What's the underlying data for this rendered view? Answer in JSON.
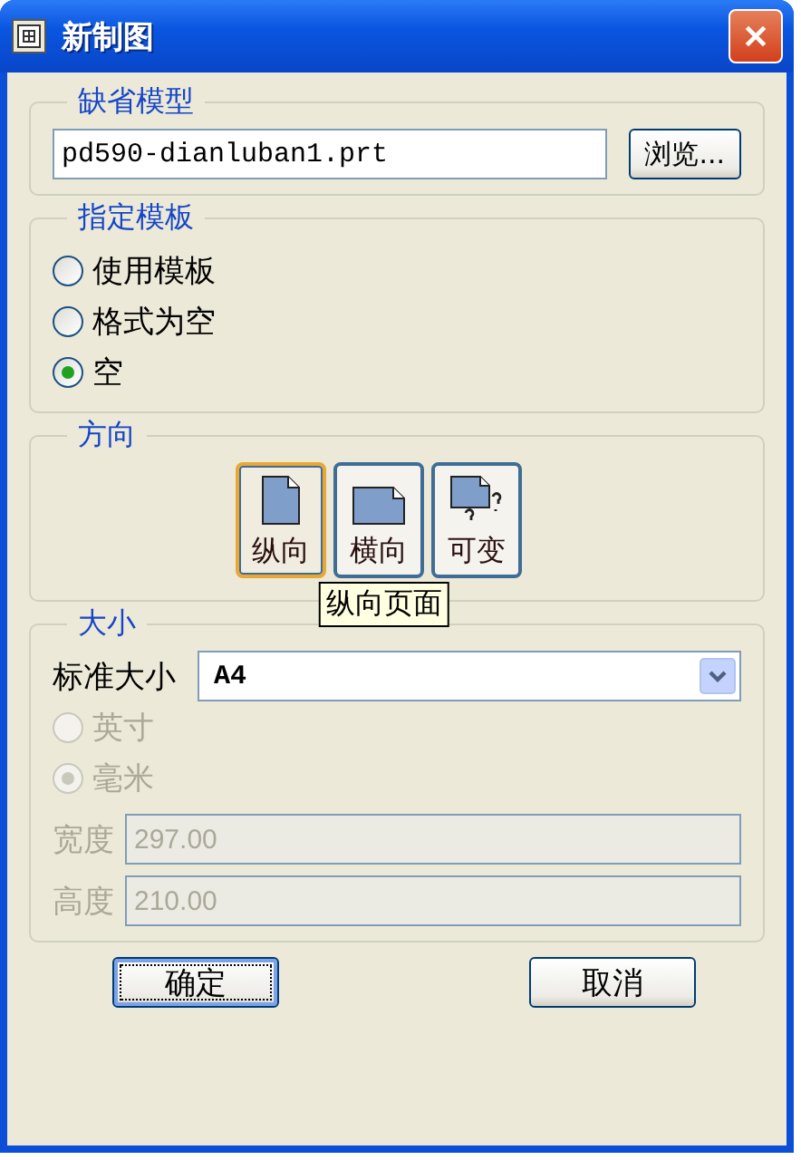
{
  "window": {
    "title": "新制图"
  },
  "default_model": {
    "legend": "缺省模型",
    "value": "pd590-dianluban1.prt",
    "browse_button": "浏览..."
  },
  "template": {
    "legend": "指定模板",
    "options": [
      {
        "label": "使用模板",
        "selected": false
      },
      {
        "label": "格式为空",
        "selected": false
      },
      {
        "label": "空",
        "selected": true
      }
    ]
  },
  "orientation": {
    "legend": "方向",
    "buttons": [
      {
        "kind": "portrait",
        "label": "纵向",
        "selected": true
      },
      {
        "kind": "landscape",
        "label": "横向",
        "selected": false
      },
      {
        "kind": "variable",
        "label": "可变",
        "selected": false
      }
    ],
    "tooltip": "纵向页面"
  },
  "size": {
    "legend": "大小",
    "standard_label": "标准大小",
    "standard_value": "A4",
    "units": [
      {
        "label": "英寸",
        "selected": false,
        "disabled": true
      },
      {
        "label": "毫米",
        "selected": true,
        "disabled": true
      }
    ],
    "fields": [
      {
        "label": "宽度",
        "value": "297.00",
        "disabled": true
      },
      {
        "label": "高度",
        "value": "210.00",
        "disabled": true
      }
    ]
  },
  "buttons": [
    {
      "label": "确定",
      "focused": true
    },
    {
      "label": "取消",
      "focused": false
    }
  ]
}
